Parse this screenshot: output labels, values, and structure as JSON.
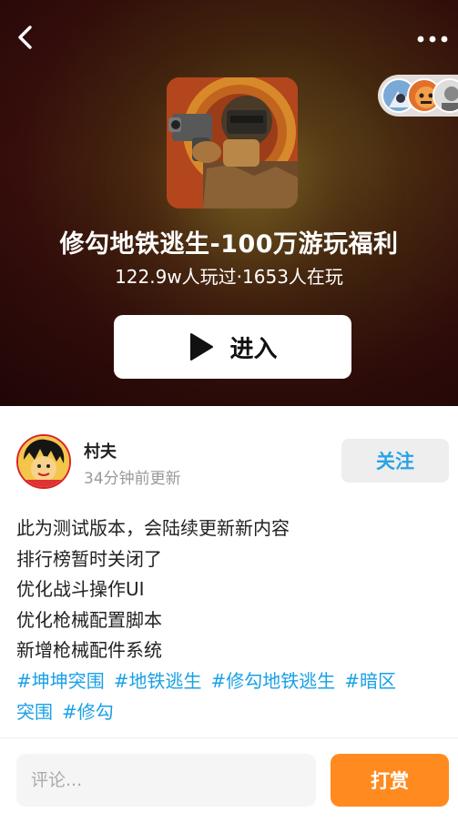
{
  "header": {
    "back_icon": "chevron-left-icon",
    "more_icon": "more-dots-icon"
  },
  "game": {
    "title": "修勾地铁逃生-100万游玩福利",
    "stats": "122.9w人玩过·1653人在玩",
    "enter_label": "进入",
    "enter_icon": "play-icon"
  },
  "author": {
    "name": "村夫",
    "time": "34分钟前更新",
    "follow_label": "关注"
  },
  "post": {
    "lines": [
      "此为测试版本，会陆续更新新内容",
      "排行榜暂时关闭了",
      "优化战斗操作UI",
      "优化枪械配置脚本",
      "新增枪械配件系统"
    ],
    "tags": [
      "#坤坤突围",
      "#地铁逃生",
      "#修勾地铁逃生",
      "#暗区",
      "突围",
      "#修勾"
    ]
  },
  "bottom": {
    "comment_placeholder": "评论...",
    "reward_label": "打赏"
  },
  "colors": {
    "accent_blue": "#1aa0e6",
    "reward_orange": "#ff8a1f"
  }
}
